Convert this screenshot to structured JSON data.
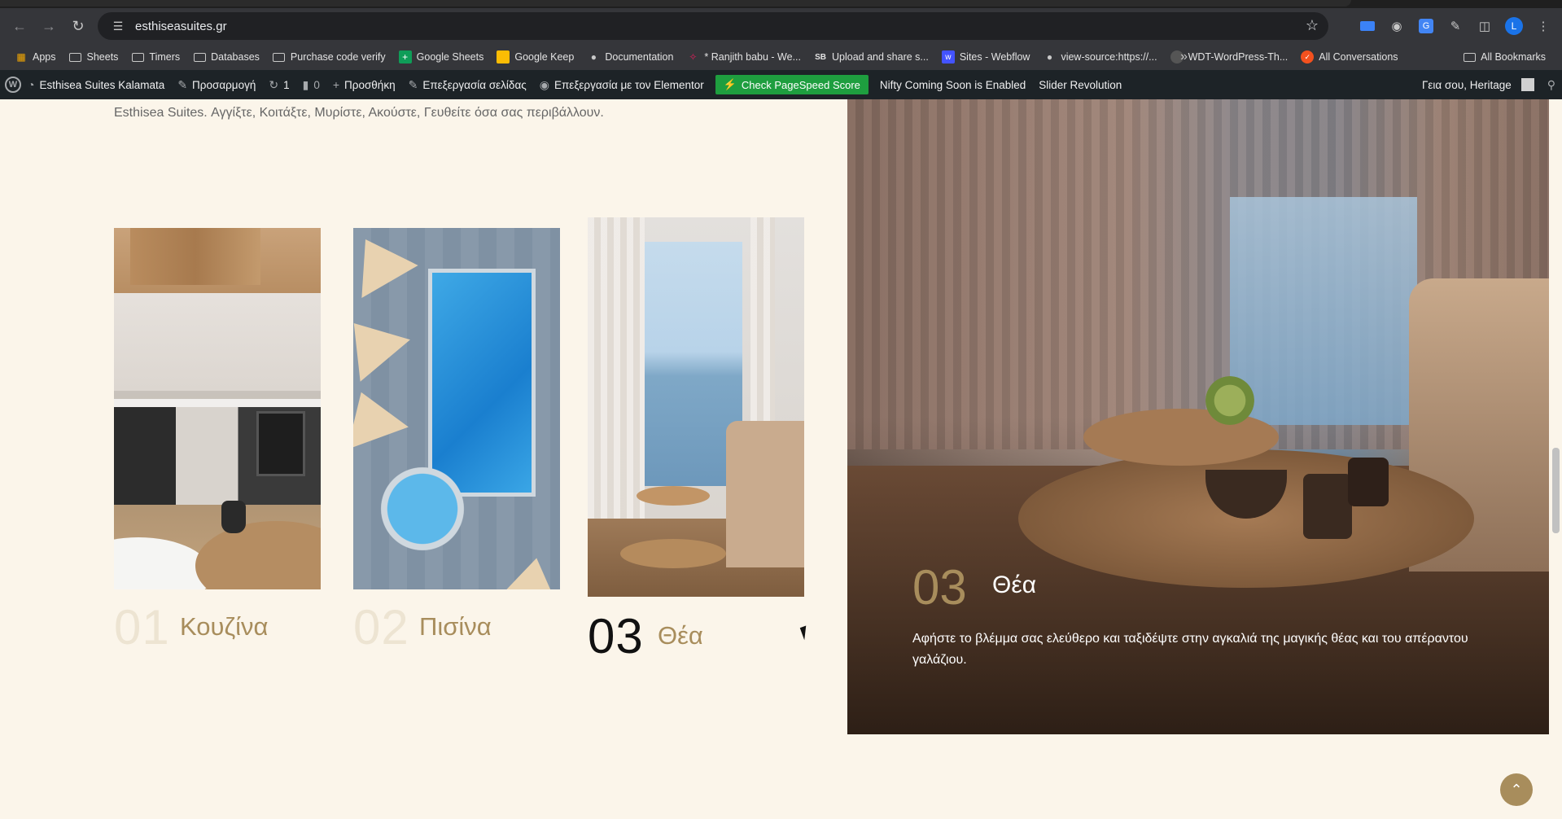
{
  "browser": {
    "url": "esthiseasuites.gr",
    "avatar_letter": "L",
    "bookmarks": [
      {
        "label": "Apps",
        "icon": "apps-grid-icon"
      },
      {
        "label": "Sheets",
        "icon": "folder-icon"
      },
      {
        "label": "Timers",
        "icon": "folder-icon"
      },
      {
        "label": "Databases",
        "icon": "folder-icon"
      },
      {
        "label": "Purchase code verify",
        "icon": "folder-icon"
      },
      {
        "label": "Google Sheets",
        "icon": "google-sheets-icon"
      },
      {
        "label": "Google Keep",
        "icon": "google-keep-icon"
      },
      {
        "label": "Documentation",
        "icon": "globe-icon"
      },
      {
        "label": "* Ranjith babu - We...",
        "icon": "slack-icon"
      },
      {
        "label": "Upload and share s...",
        "icon": "sb-icon"
      },
      {
        "label": "Sites - Webflow",
        "icon": "webflow-icon"
      },
      {
        "label": "view-source:https://...",
        "icon": "globe-icon"
      },
      {
        "label": "WDT-WordPress-Th...",
        "icon": "github-icon"
      },
      {
        "label": "All Conversations",
        "icon": "chat-icon"
      }
    ],
    "all_bookmarks": "All Bookmarks"
  },
  "adminbar": {
    "site_name": "Esthisea Suites Kalamata",
    "customize": "Προσαρμογή",
    "updates_count": "1",
    "comments_count": "0",
    "new": "Προσθήκη",
    "edit_page": "Επεξεργασία σελίδας",
    "edit_elementor": "Επεξεργασία με τον Elementor",
    "pagespeed": "Check PageSpeed Score",
    "nifty": "Nifty Coming Soon is Enabled",
    "slider": "Slider Revolution",
    "greeting": "Γεια σου, Heritage"
  },
  "content": {
    "intro_text": "Esthisea Suites. Αγγίξτε, Κοιτάξτε, Μυρίστε, Ακούστε, Γευθείτε όσα σας περιβάλλουν.",
    "cards": [
      {
        "num": "01",
        "label": "Κουζίνα"
      },
      {
        "num": "02",
        "label": "Πισίνα"
      },
      {
        "num": "03",
        "label": "Θέα"
      }
    ],
    "feature": {
      "num": "03",
      "title": "Θέα",
      "text": "Αφήστε το βλέμμα σας ελεύθερο και ταξιδέψτε στην αγκαλιά της μαγικής θέας και του απέραντου γαλάζιου."
    }
  },
  "colors": {
    "page_bg": "#fbf5ea",
    "accent_gold": "#a88d5c",
    "adminbar_bg": "#1d2327",
    "pagespeed_green": "#1e9e3f"
  }
}
